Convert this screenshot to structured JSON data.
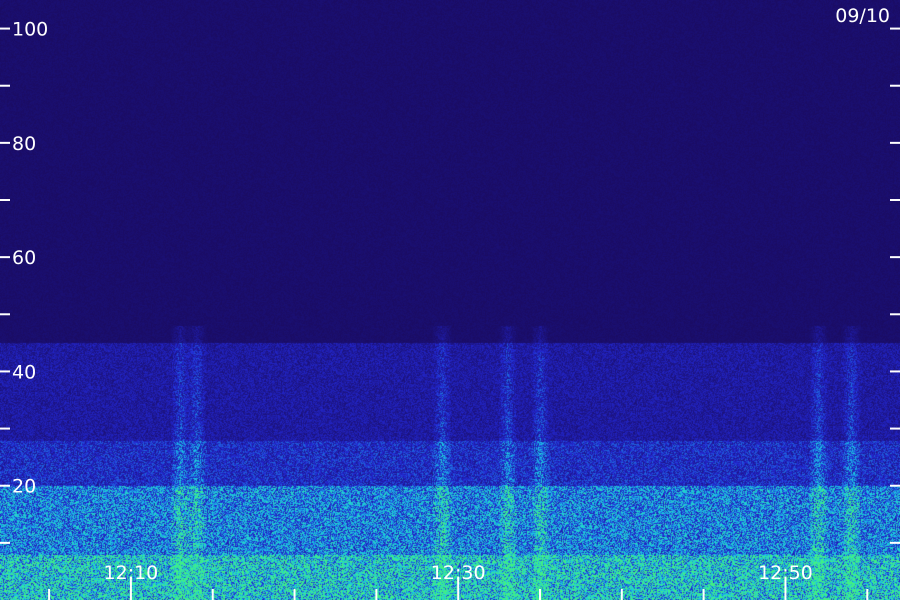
{
  "chart_data": {
    "type": "heatmap",
    "title": "",
    "date_label": "09/10",
    "xlabel": "",
    "ylabel": "",
    "y_range": [
      0,
      105
    ],
    "y_major_ticks": [
      20,
      40,
      60,
      80,
      100
    ],
    "y_minor_ticks": [
      10,
      30,
      50,
      70,
      90
    ],
    "y_tick_labels": [
      "20",
      "40",
      "60",
      "80",
      "100"
    ],
    "x_range_minutes": [
      "12:02",
      "12:57"
    ],
    "x_major_ticks": [
      "12:10",
      "12:30",
      "12:50"
    ],
    "x_tick_labels": [
      "12:10",
      "12:30",
      "12:50"
    ],
    "x_minor_ticks": [
      "12:05",
      "12:15",
      "12:20",
      "12:25",
      "12:35",
      "12:40",
      "12:45",
      "12:55"
    ],
    "colors": {
      "background_low": "#190a5c",
      "mid": "#2a40d8",
      "high": "#1ad4e0",
      "peak": "#3cf080",
      "ticks": "#ffffff"
    },
    "intensity_bands": [
      {
        "from": 0,
        "to": 8,
        "level": 0.85
      },
      {
        "from": 8,
        "to": 20,
        "level": 0.6
      },
      {
        "from": 20,
        "to": 28,
        "level": 0.35
      },
      {
        "from": 28,
        "to": 45,
        "level": 0.22
      },
      {
        "from": 45,
        "to": 105,
        "level": 0.05
      }
    ],
    "vertical_bursts": [
      "12:13",
      "12:14",
      "12:29",
      "12:33",
      "12:35",
      "12:52",
      "12:54"
    ]
  }
}
